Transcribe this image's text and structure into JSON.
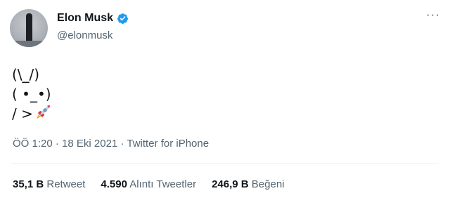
{
  "author": {
    "name": "Elon Musk",
    "handle": "@elonmusk",
    "verified_icon": "verified-badge-icon"
  },
  "more_icon": "more-options-icon",
  "tweet": {
    "lines": [
      "(\\_/)",
      "( •_•)",
      "/ >"
    ],
    "emoji_icon": "rocket-icon"
  },
  "meta": {
    "time": "ÖÖ 1:20",
    "date": "18 Eki 2021",
    "source": "Twitter for iPhone",
    "separator": "·"
  },
  "stats": [
    {
      "count": "35,1 B",
      "label": "Retweet"
    },
    {
      "count": "4.590",
      "label": "Alıntı Tweetler"
    },
    {
      "count": "246,9 B",
      "label": "Beğeni"
    }
  ],
  "colors": {
    "verified": "#1d9bf0",
    "text": "#0f1419",
    "secondary": "#536471"
  }
}
